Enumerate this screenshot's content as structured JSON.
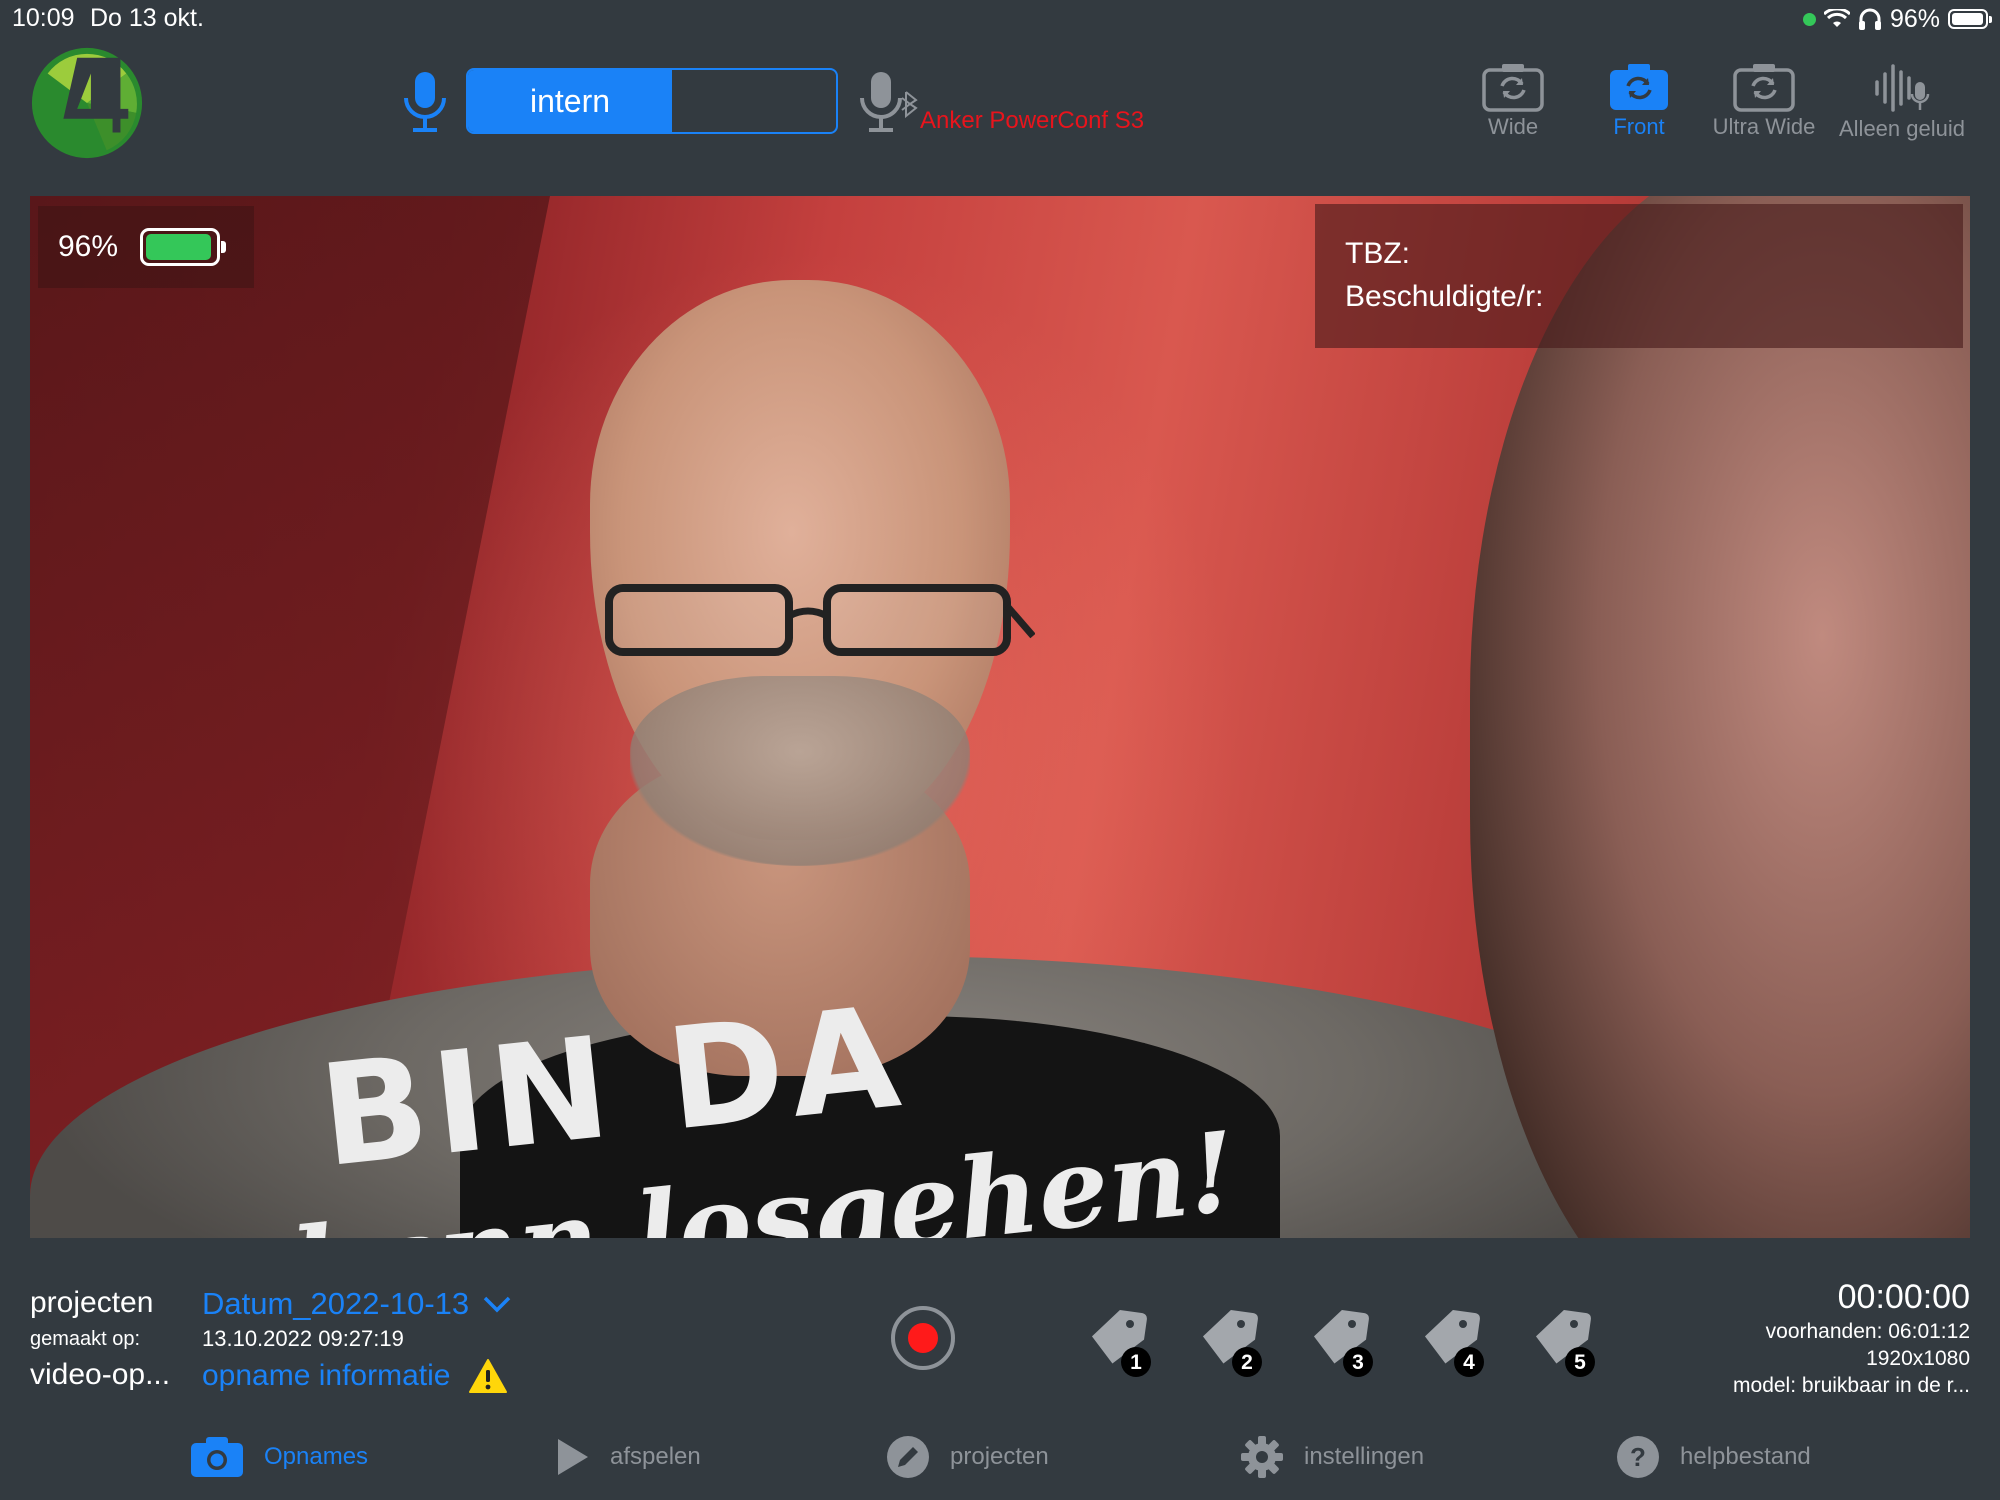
{
  "status_bar": {
    "time": "10:09",
    "date": "Do 13 okt.",
    "battery_percent": "96%",
    "battery_level": 0.96,
    "icons": [
      "green-dot",
      "wifi-icon",
      "headphones-icon",
      "battery-icon"
    ]
  },
  "colors": {
    "accent": "#1a82f7",
    "background": "#333a40",
    "inactive": "#8e9399",
    "record": "#ff1a1a",
    "bluetooth_device": "#e8141c",
    "battery_green": "#34c759"
  },
  "toolbar": {
    "mic_source_active": "intern",
    "bluetooth_device": "Anker PowerConf S3",
    "cameras": [
      {
        "label": "Wide",
        "active": false
      },
      {
        "label": "Front",
        "active": true
      },
      {
        "label": "Ultra Wide",
        "active": false
      },
      {
        "label": "Alleen geluid",
        "active": false
      }
    ]
  },
  "preview": {
    "battery_percent": "96%",
    "battery_level": 0.96,
    "tbz_label": "TBZ:",
    "beschuldigte_label": "Beschuldigte/r:",
    "shirt_text": "BIN DA",
    "shirt_subtext": "kann losgehen!"
  },
  "session": {
    "projecten_label": "projecten",
    "project_name": "Datum_2022-10-13",
    "gemaakt_label": "gemaakt op:",
    "gemaakt_value": "13.10.2022 09:27:19",
    "video_label": "video-op...",
    "opname_info": "opname informatie"
  },
  "tags": [
    "1",
    "2",
    "3",
    "4",
    "5"
  ],
  "recording_info": {
    "timer": "00:00:00",
    "available": "voorhanden: 06:01:12",
    "resolution": "1920x1080",
    "model": "model: bruikbaar in de r..."
  },
  "tabs": [
    {
      "label": "Opnames",
      "icon": "camera-icon",
      "active": true
    },
    {
      "label": "afspelen",
      "icon": "play-icon",
      "active": false
    },
    {
      "label": "projecten",
      "icon": "pencil-icon",
      "active": false
    },
    {
      "label": "instellingen",
      "icon": "gear-icon",
      "active": false
    },
    {
      "label": "helpbestand",
      "icon": "help-icon",
      "active": false
    }
  ]
}
